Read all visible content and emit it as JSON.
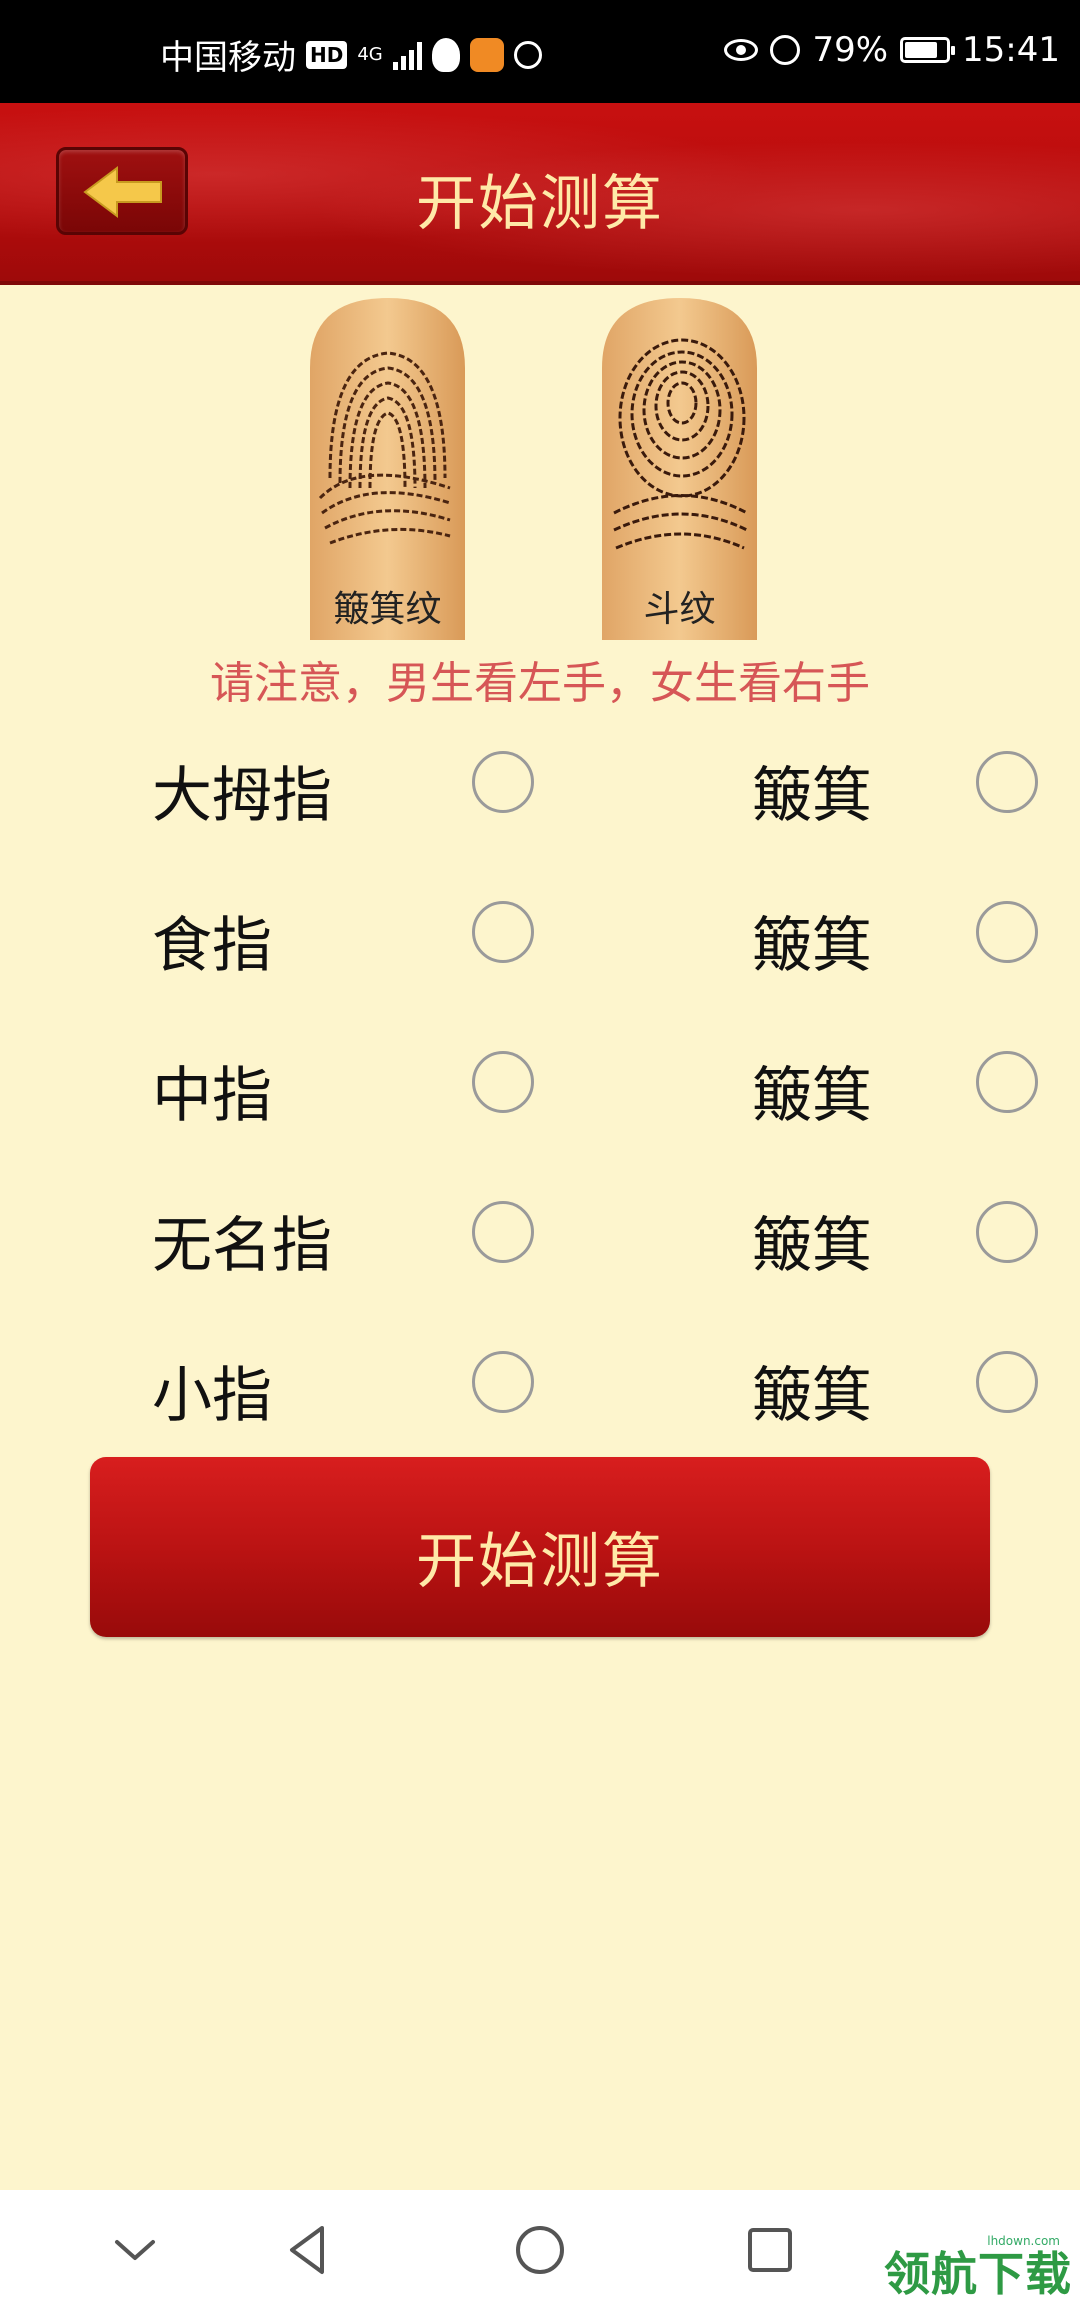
{
  "status_bar": {
    "carrier": "中国移动",
    "hd": "HD",
    "network": "4G",
    "battery_percent": "79%",
    "battery_level": 0.79,
    "time": "15:41"
  },
  "header": {
    "title": "开始测算",
    "back_icon": "arrow-left-icon"
  },
  "prints": {
    "left_label": "簸箕纹",
    "right_label": "斗纹"
  },
  "notice": "请注意，男生看左手，女生看右手",
  "rows": [
    {
      "finger": "大拇指",
      "type": "簸箕"
    },
    {
      "finger": "食指",
      "type": "簸箕"
    },
    {
      "finger": "中指",
      "type": "簸箕"
    },
    {
      "finger": "无名指",
      "type": "簸箕"
    },
    {
      "finger": "小指",
      "type": "簸箕"
    }
  ],
  "start_button": "开始测算",
  "nav": {
    "collapse_icon": "chevron-down-icon",
    "back_icon": "triangle-back-icon",
    "home_icon": "circle-home-icon",
    "recent_icon": "square-recent-icon"
  },
  "watermark": {
    "text": "领航下载",
    "small": "lhdown.com"
  }
}
